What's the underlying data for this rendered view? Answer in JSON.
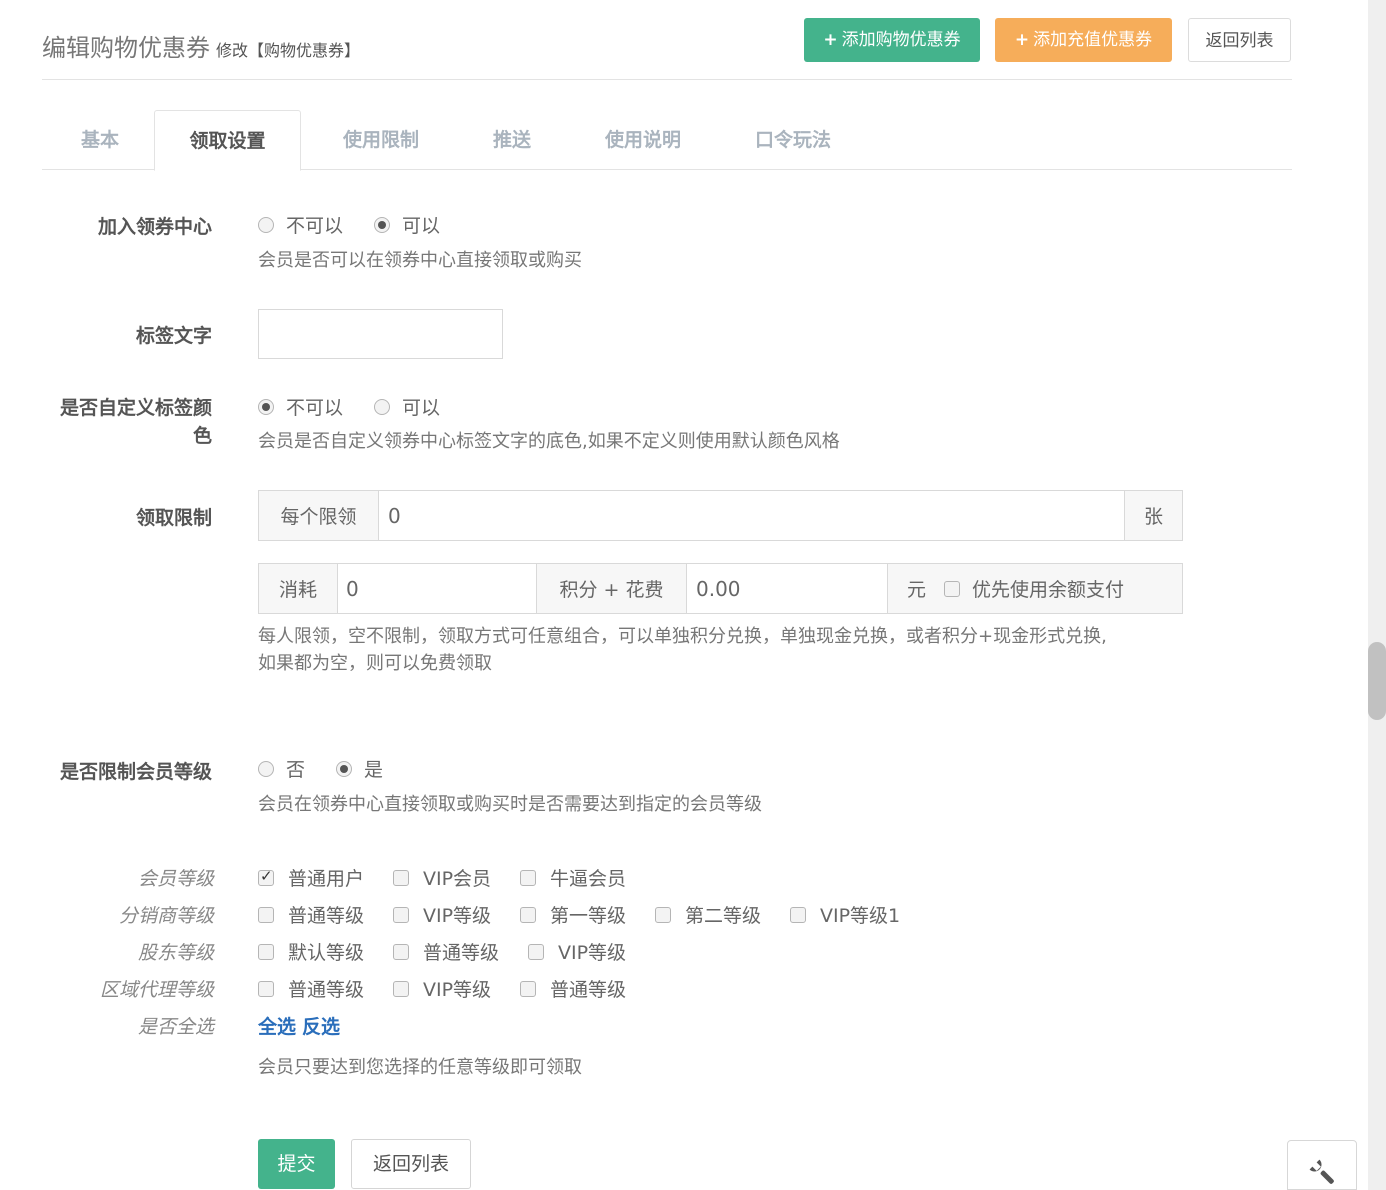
{
  "header": {
    "title": "编辑购物优惠券",
    "subtitle": "修改【购物优惠券】",
    "add_shop_coupon": "添加购物优惠券",
    "add_recharge_coupon": "添加充值优惠券",
    "back_to_list": "返回列表"
  },
  "tabs": [
    {
      "label": "基本",
      "active": false
    },
    {
      "label": "领取设置",
      "active": true
    },
    {
      "label": "使用限制",
      "active": false
    },
    {
      "label": "推送",
      "active": false
    },
    {
      "label": "使用说明",
      "active": false
    },
    {
      "label": "口令玩法",
      "active": false
    }
  ],
  "join_center": {
    "label": "加入领券中心",
    "options": [
      "不可以",
      "可以"
    ],
    "selected": "可以",
    "help": "会员是否可以在领券中心直接领取或购买"
  },
  "tag_text": {
    "label": "标签文字",
    "value": ""
  },
  "custom_tag_color": {
    "label_line1": "是否自定义标签颜",
    "label_line2": "色",
    "options": [
      "不可以",
      "可以"
    ],
    "selected": "不可以",
    "help": "会员是否自定义领券中心标签文字的底色,如果不定义则使用默认颜色风格"
  },
  "claim_limit": {
    "label": "领取限制",
    "per_person_label": "每个限领",
    "per_person_value": "0",
    "per_person_unit": "张",
    "consume_label": "消耗",
    "points_value": "0",
    "points_plus_fee_label": "积分 + 花费",
    "money_value": "0.00",
    "money_unit": "元",
    "balance_pay_label": "优先使用余额支付",
    "balance_pay_checked": false,
    "help_line1": "每人限领，空不限制，领取方式可任意组合，可以单独积分兑换，单独现金兑换，或者积分+现金形式兑换,",
    "help_line2": "如果都为空，则可以免费领取"
  },
  "limit_member_level": {
    "label": "是否限制会员等级",
    "options": [
      "否",
      "是"
    ],
    "selected": "是",
    "help": "会员在领券中心直接领取或购买时是否需要达到指定的会员等级"
  },
  "level_groups": [
    {
      "label": "会员等级",
      "items": [
        {
          "label": "普通用户",
          "checked": true
        },
        {
          "label": "VIP会员",
          "checked": false
        },
        {
          "label": "牛逼会员",
          "checked": false
        }
      ]
    },
    {
      "label": "分销商等级",
      "items": [
        {
          "label": "普通等级",
          "checked": false
        },
        {
          "label": "VIP等级",
          "checked": false
        },
        {
          "label": "第一等级",
          "checked": false
        },
        {
          "label": "第二等级",
          "checked": false
        },
        {
          "label": "VIP等级1",
          "checked": false
        }
      ]
    },
    {
      "label": "股东等级",
      "items": [
        {
          "label": "默认等级",
          "checked": false
        },
        {
          "label": "普通等级",
          "checked": false
        },
        {
          "label": "VIP等级",
          "checked": false
        }
      ]
    },
    {
      "label": "区域代理等级",
      "items": [
        {
          "label": "普通等级",
          "checked": false
        },
        {
          "label": "VIP等级",
          "checked": false
        },
        {
          "label": "普通等级",
          "checked": false
        }
      ]
    }
  ],
  "select_all": {
    "label": "是否全选",
    "all": "全选",
    "invert": "反选"
  },
  "level_help": "会员只要达到您选择的任意等级即可领取",
  "footer": {
    "submit": "提交",
    "back": "返回列表"
  },
  "icons": {
    "plus": "plus-icon",
    "tool": "wrench-icon"
  }
}
